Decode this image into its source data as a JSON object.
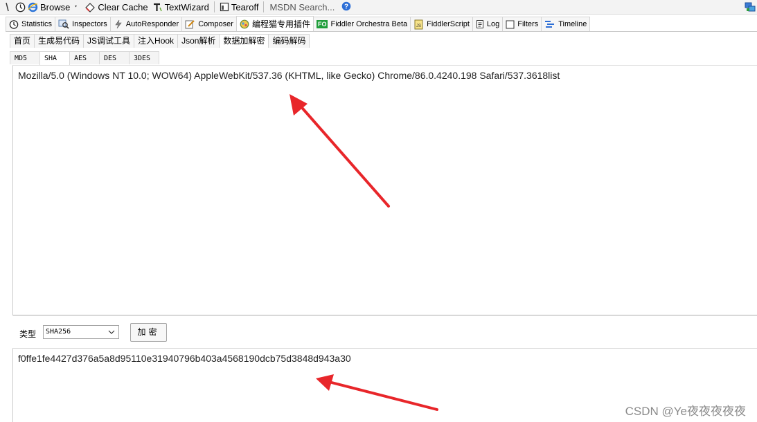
{
  "toolbar": {
    "browse_label": "Browse",
    "clear_cache_label": "Clear Cache",
    "textwizard_label": "TextWizard",
    "tearoff_label": "Tearoff",
    "search_placeholder": "MSDN Search..."
  },
  "main_tabs": [
    {
      "label": "Statistics"
    },
    {
      "label": "Inspectors"
    },
    {
      "label": "AutoResponder"
    },
    {
      "label": "Composer"
    },
    {
      "label": "编程猫专用插件"
    },
    {
      "label": "Fiddler Orchestra Beta",
      "badge": "FO"
    },
    {
      "label": "FiddlerScript"
    },
    {
      "label": "Log"
    },
    {
      "label": "Filters"
    },
    {
      "label": "Timeline"
    }
  ],
  "sub_tabs": [
    "首页",
    "生成易代码",
    "JS调试工具",
    "注入Hook",
    "Json解析",
    "数据加解密",
    "编码解码"
  ],
  "algo_tabs": [
    "MD5",
    "SHA",
    "AES",
    "DES",
    "3DES"
  ],
  "input": {
    "text": "Mozilla/5.0 (Windows NT 10.0; WOW64) AppleWebKit/537.36 (KHTML, like Gecko) Chrome/86.0.4240.198 Safari/537.3618list"
  },
  "controls": {
    "type_label": "类型",
    "type_value": "SHA256",
    "encrypt_label": "加密"
  },
  "output": {
    "text": "f0ffe1fe4427d376a5a8d95110e31940796b403a4568190dcb75d3848d943a30"
  },
  "watermark": "CSDN @Ye夜夜夜夜夜",
  "colors": {
    "arrow": "#e8262a",
    "fo_badge": "#1f9d3a",
    "help_icon": "#2c6ed6"
  }
}
